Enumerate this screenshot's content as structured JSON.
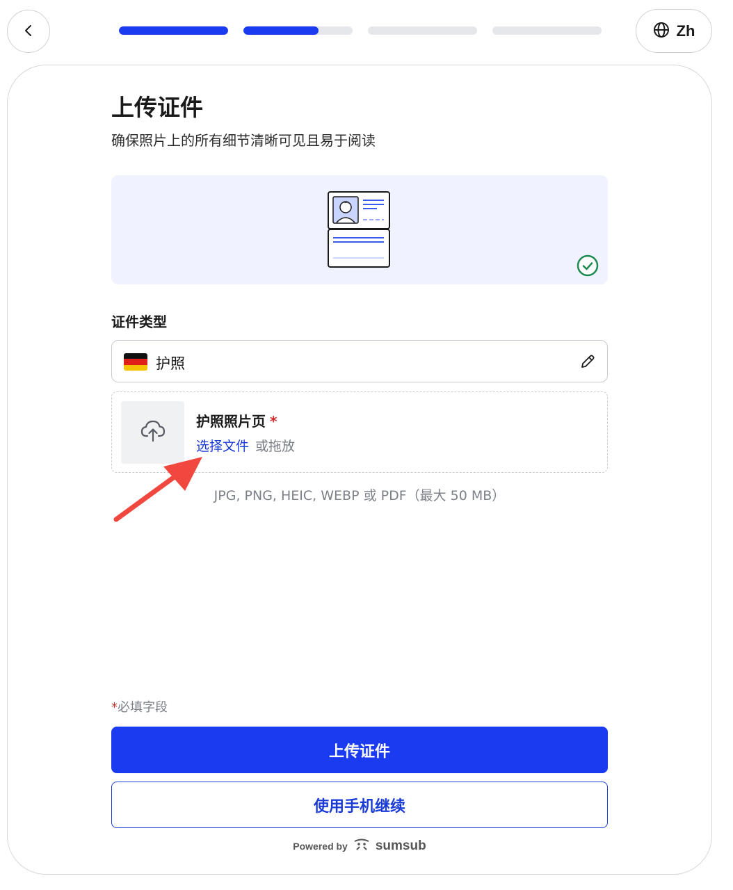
{
  "header": {
    "progress": [
      1.0,
      0.69,
      0.0,
      0.0
    ],
    "language": "Zh"
  },
  "main": {
    "title": "上传证件",
    "subtitle": "确保照片上的所有细节清晰可见且易于阅读",
    "doc_type_label": "证件类型",
    "doc_type_value": "护照",
    "upload": {
      "title": "护照照片页",
      "required_mark": "*",
      "choose_file": "选择文件",
      "or_drag": "或拖放"
    },
    "formats": "JPG, PNG, HEIC, WEBP 或 PDF（最大 50 MB）"
  },
  "footer": {
    "required_star": "*",
    "required_note": "必填字段",
    "primary_button": "上传证件",
    "secondary_button": "使用手机继续",
    "powered_by": "Powered by",
    "brand": "sumsub"
  },
  "colors": {
    "accent": "#1a3bf0",
    "success": "#1a8a4f",
    "annotation_arrow": "#f0483e"
  }
}
